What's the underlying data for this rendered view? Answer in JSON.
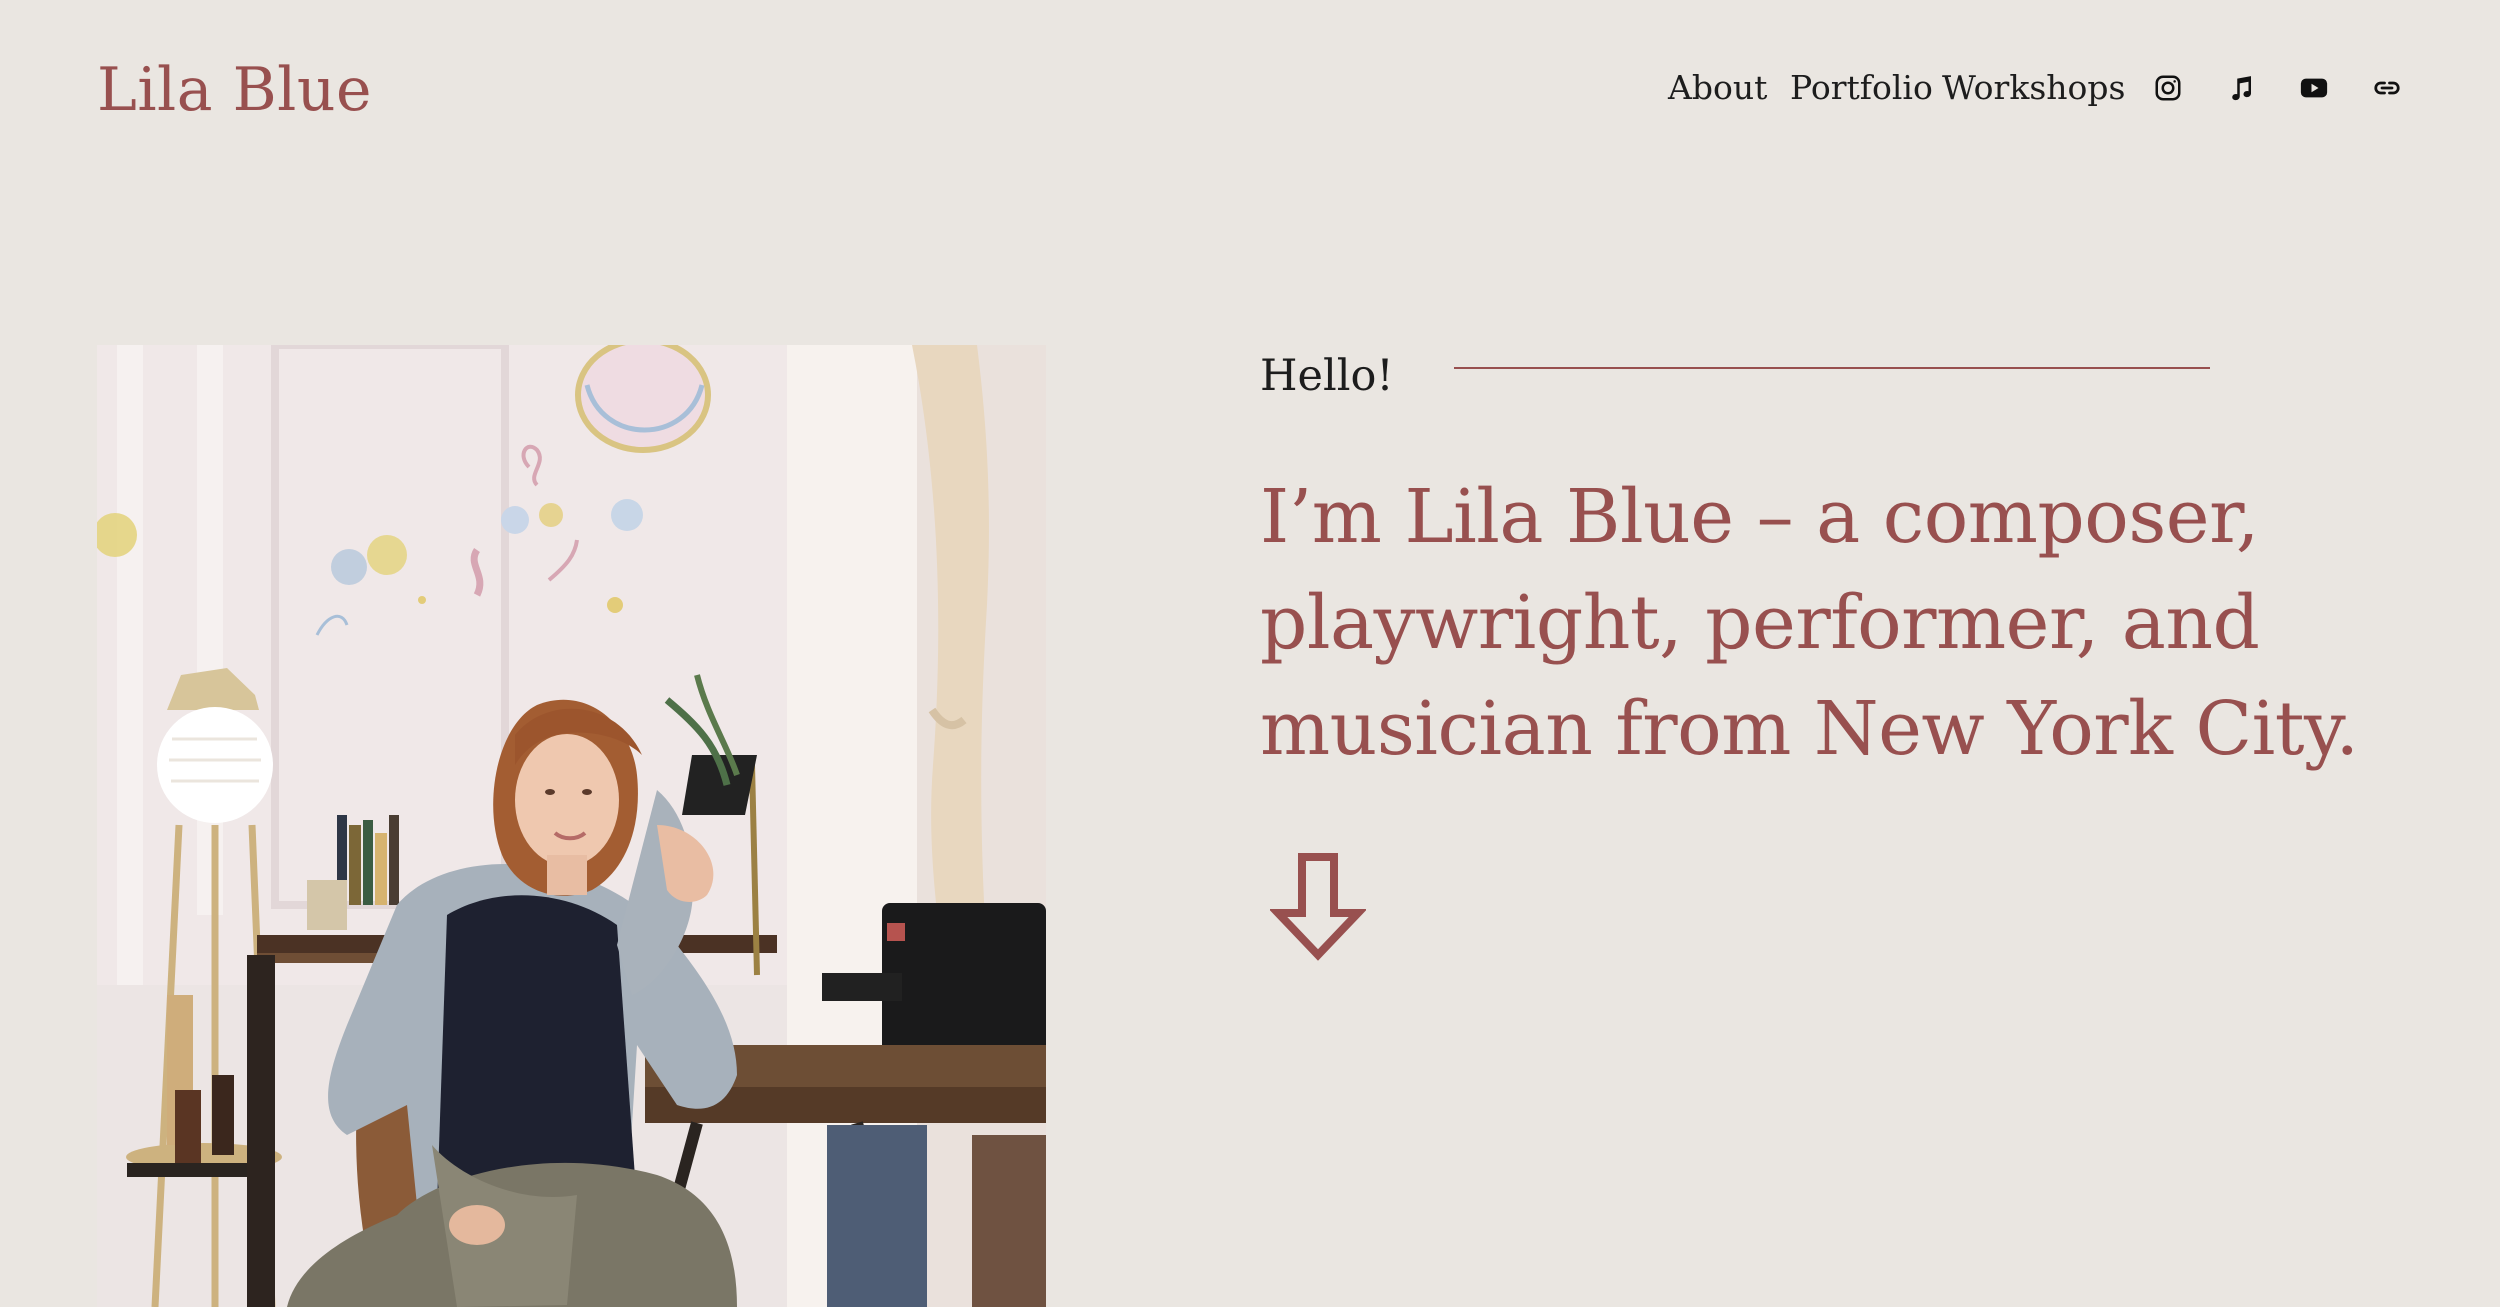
{
  "header": {
    "site_title": "Lila Blue",
    "nav": [
      {
        "label": "About"
      },
      {
        "label": "Portfolio"
      },
      {
        "label": "Workshops"
      }
    ],
    "social_icons": [
      "instagram-icon",
      "music-note-icon",
      "youtube-icon",
      "link-icon"
    ]
  },
  "hero": {
    "photo_alt": "Lila Blue seated at a wooden desk in a bright room",
    "hello": "Hello!",
    "headline": "I’m Lila Blue – a composer, playwright, performer, and musician from New York City.",
    "scroll_icon": "arrow-down-icon"
  },
  "colors": {
    "background": "#eae6e1",
    "accent": "#98504f",
    "text": "#1d1d1d"
  }
}
